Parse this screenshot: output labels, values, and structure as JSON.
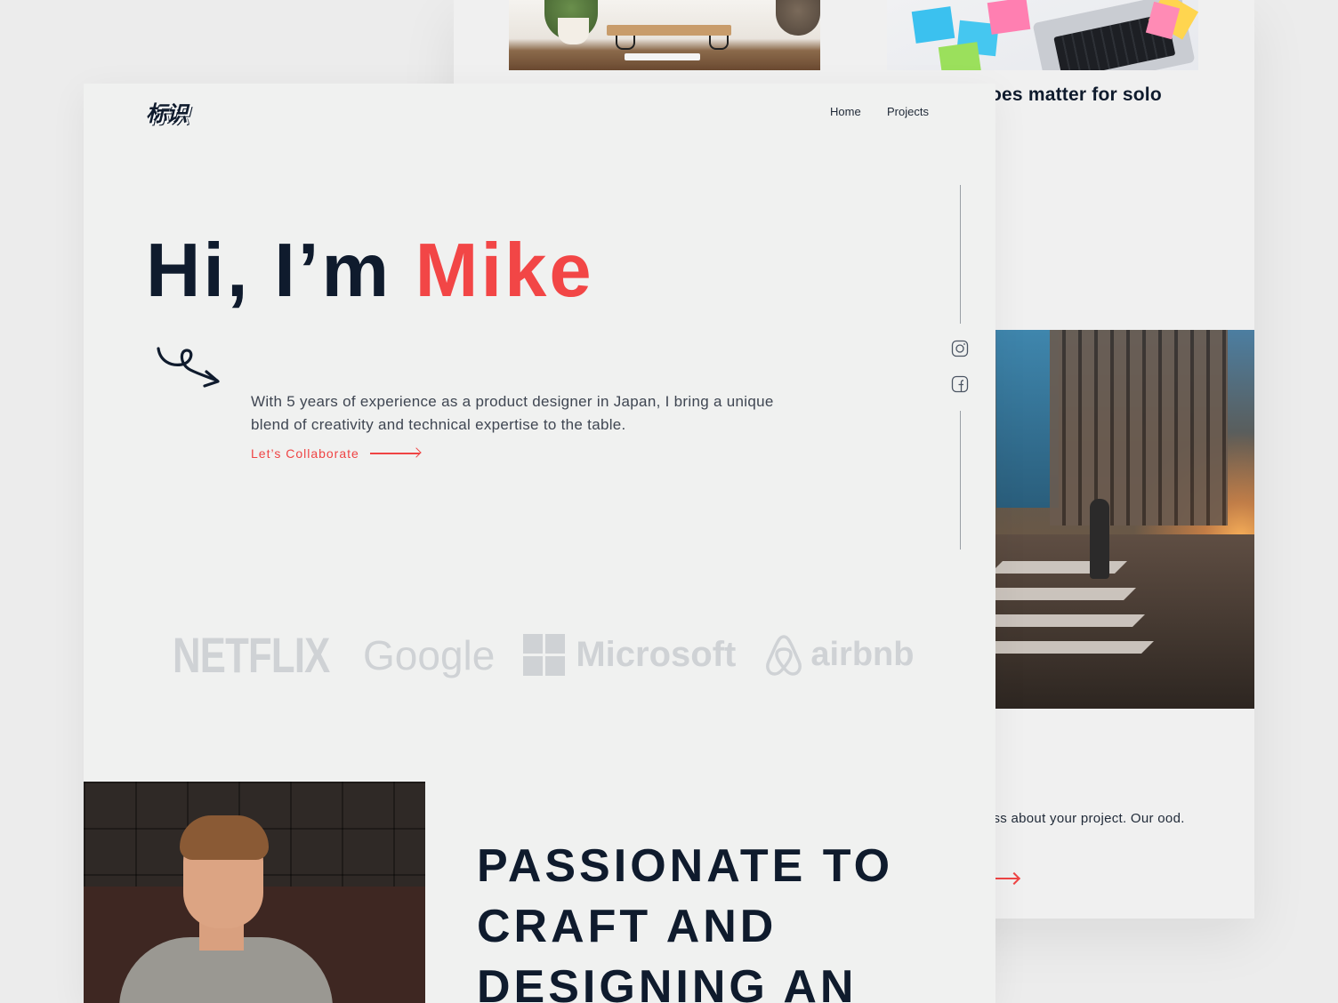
{
  "background_card": {
    "article_title": "does matter for solo",
    "body_text": "cuss about your project. Our ood.",
    "images": [
      "desk-workspace-photo",
      "sticky-notes-laptop-photo",
      "city-street-pedestrian-photo"
    ]
  },
  "header": {
    "logo_text": "标识",
    "nav": [
      {
        "label": "Home"
      },
      {
        "label": "Projects"
      }
    ]
  },
  "hero": {
    "greeting": "Hi, I’m ",
    "name": "Mike",
    "intro": "With 5 years of experience as a product designer in Japan, I bring a unique blend of creativity and technical expertise to the table.",
    "cta_label": "Let’s Collaborate"
  },
  "social": [
    {
      "icon": "instagram-icon"
    },
    {
      "icon": "facebook-icon"
    }
  ],
  "brands": [
    {
      "name": "NETFLIX"
    },
    {
      "name": "Google"
    },
    {
      "name": "Microsoft"
    },
    {
      "name": "airbnb"
    }
  ],
  "about": {
    "heading_lines": [
      "PASSIONATE TO",
      "CRAFT AND",
      "DESIGNING AN"
    ]
  },
  "colors": {
    "accent": "#f24646",
    "navy": "#0f1b2d",
    "brand_gray": "#cfd2d5"
  }
}
